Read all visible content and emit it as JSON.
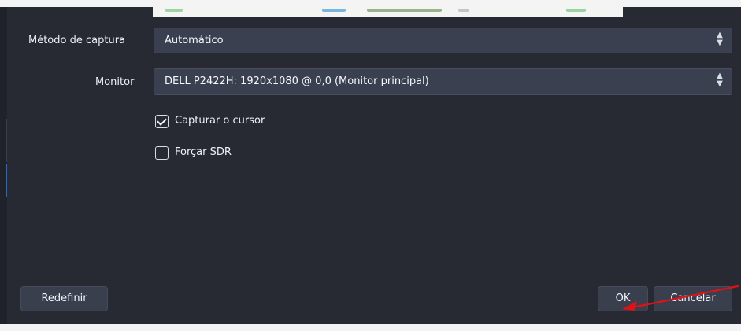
{
  "fields": {
    "capture_method": {
      "label": "Método de captura",
      "value": "Automático"
    },
    "monitor": {
      "label": "Monitor",
      "value": "DELL P2422H: 1920x1080 @ 0,0 (Monitor principal)"
    }
  },
  "options": {
    "capture_cursor": {
      "label": "Capturar o cursor",
      "checked": true
    },
    "force_sdr": {
      "label": "Forçar SDR",
      "checked": false
    }
  },
  "buttons": {
    "reset_label": "Redefinir",
    "ok_label": "OK",
    "cancel_label": "Cancelar"
  },
  "icons": {
    "combo_arrow_up": "▲",
    "combo_arrow_down": "▼"
  },
  "colors": {
    "dialog_background": "#272a33",
    "input_background": "#3b4050",
    "annotation_arrow": "#e01218",
    "selection_accent": "#2b69c9"
  }
}
